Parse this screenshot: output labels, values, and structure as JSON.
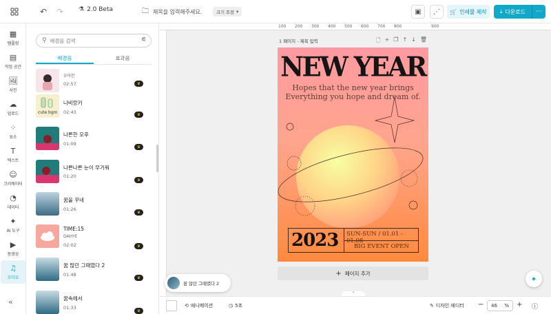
{
  "topbar": {
    "version_label": "2.0 Beta",
    "doc_title_placeholder": "제목을 입력해주세요.",
    "resize_label": "크기 조정",
    "print_label": "인쇄물 제작",
    "download_label": "다운로드"
  },
  "rail": {
    "items": [
      {
        "label": "템플릿",
        "icon": "template-icon"
      },
      {
        "label": "작업 공간",
        "icon": "workspace-icon"
      },
      {
        "label": "사진",
        "icon": "photo-icon"
      },
      {
        "label": "업로드",
        "icon": "upload-icon"
      },
      {
        "label": "요소",
        "icon": "elements-icon"
      },
      {
        "label": "텍스트",
        "icon": "text-icon"
      },
      {
        "label": "크리에이터",
        "icon": "creator-icon"
      },
      {
        "label": "데이터",
        "icon": "data-icon"
      },
      {
        "label": "AI 도구",
        "icon": "ai-icon"
      },
      {
        "label": "동영상",
        "icon": "video-icon"
      },
      {
        "label": "오디오",
        "icon": "audio-icon",
        "active": true
      }
    ]
  },
  "panel": {
    "search_placeholder": "배경음 검색",
    "tabs": [
      {
        "label": "배경음",
        "active": true
      },
      {
        "label": "효과음"
      }
    ],
    "tracks": [
      {
        "title": "",
        "artist": "우아한",
        "duration": "02:57"
      },
      {
        "title": "나비랑키",
        "artist": "",
        "duration": "02:43",
        "thumb_text": "cute bgm"
      },
      {
        "title": "나른한 오후",
        "artist": "",
        "duration": "01:09"
      },
      {
        "title": "나른나른 눈이 무거워",
        "artist": "",
        "duration": "01:20"
      },
      {
        "title": "꿈을 꾸네",
        "artist": "",
        "duration": "01:26"
      },
      {
        "title": "TIME:15",
        "artist": "DAHYE",
        "duration": "02:02"
      },
      {
        "title": "꿈 많던 그때였다 2",
        "artist": "",
        "duration": "01:48"
      },
      {
        "title": "꿈속에서",
        "artist": "",
        "duration": "01:33"
      }
    ]
  },
  "ruler": {
    "ticks": [
      "100",
      "200",
      "300",
      "400",
      "500",
      "600",
      "700",
      "800",
      "900"
    ]
  },
  "page": {
    "label": "1 페이지 - 제목 입력",
    "add_page_label": "페이지 추가"
  },
  "poster": {
    "title": "NEW YEAR",
    "subtitle_line1": "Hopes that the new year brings",
    "subtitle_line2": "Everything you hope and dream of.",
    "year": "2023",
    "dates": "SUN-SUN / 01.01 - 01.08",
    "event": "BIG EVENT OPEN"
  },
  "now_playing": {
    "title": "꿈 많던 그때였다 2"
  },
  "bottombar": {
    "animation_label": "애니메이션",
    "duration_label": "5초",
    "design_editor_label": "디자인 에디터",
    "zoom_value": "46",
    "zoom_unit": "%"
  },
  "colors": {
    "accent": "#12a9c9",
    "poster_top": "#ff9aa2",
    "poster_bottom": "#ff8a3d"
  }
}
